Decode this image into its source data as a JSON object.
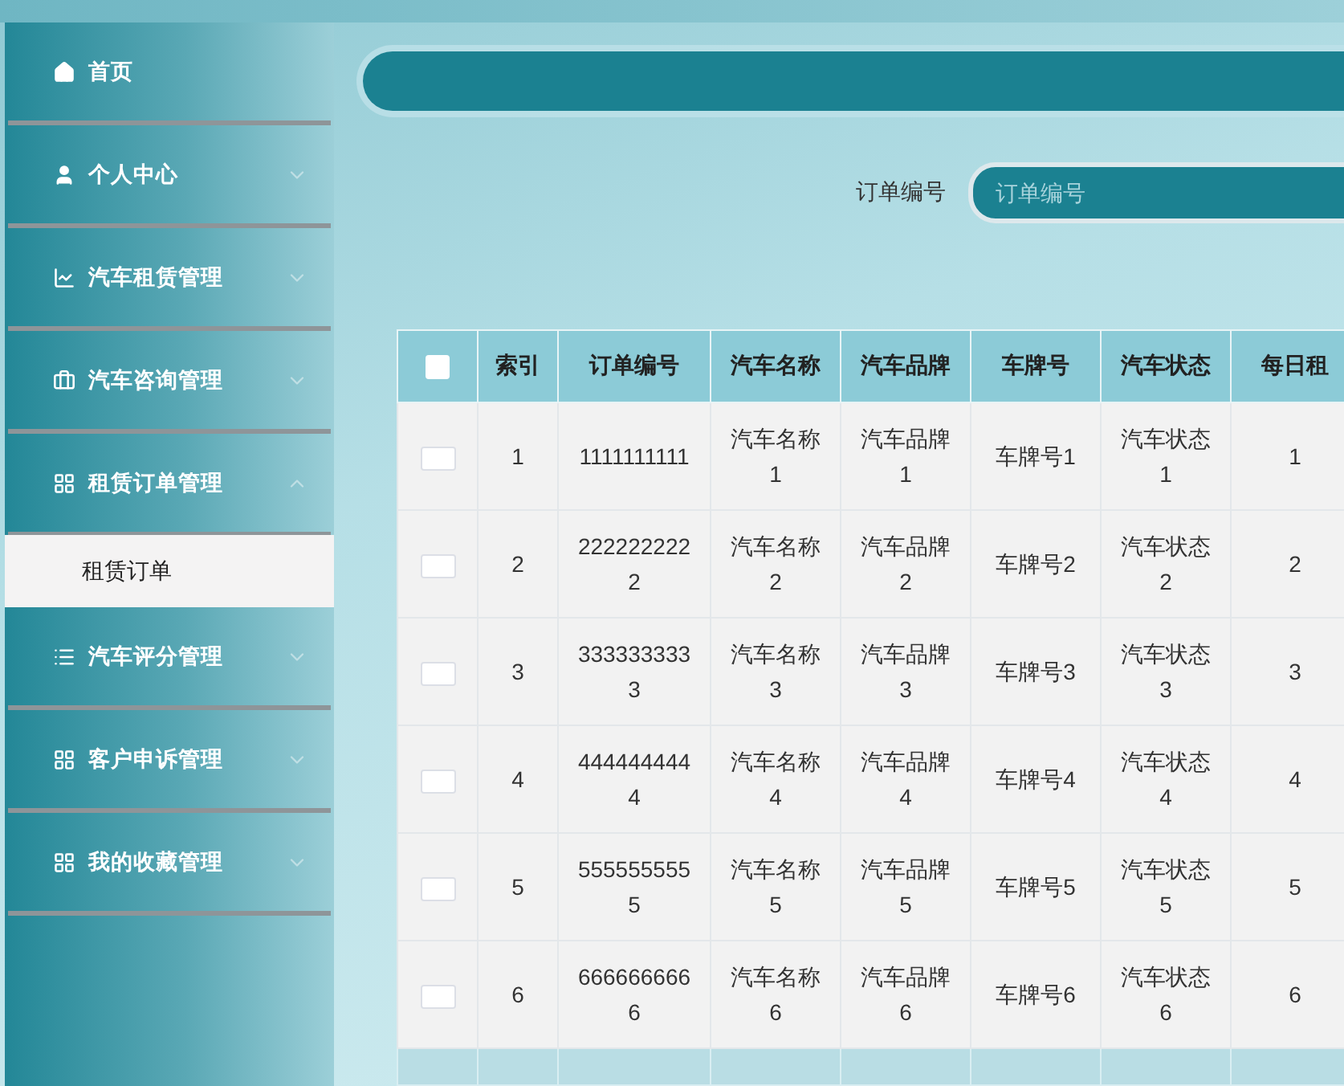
{
  "sidebar": {
    "items": [
      {
        "label": "首页"
      },
      {
        "label": "个人中心",
        "expanded": false
      },
      {
        "label": "汽车租赁管理",
        "expanded": false
      },
      {
        "label": "汽车咨询管理",
        "expanded": false
      },
      {
        "label": "租赁订单管理",
        "expanded": true,
        "children": [
          {
            "label": "租赁订单",
            "selected": true
          }
        ]
      },
      {
        "label": "汽车评分管理",
        "expanded": false
      },
      {
        "label": "客户申诉管理",
        "expanded": false
      },
      {
        "label": "我的收藏管理",
        "expanded": false
      }
    ]
  },
  "search": {
    "label": "订单编号",
    "placeholder": "订单编号"
  },
  "table": {
    "header_checked": false,
    "columns": [
      "索引",
      "订单编号",
      "汽车名称",
      "汽车品牌",
      "车牌号",
      "汽车状态",
      "每日租"
    ],
    "rows": [
      {
        "checked": false,
        "cells": [
          "1",
          "1111111111",
          "汽车名称1",
          "汽车品牌1",
          "车牌号1",
          "汽车状态1",
          "1"
        ]
      },
      {
        "checked": false,
        "cells": [
          "2",
          "2222222222",
          "汽车名称2",
          "汽车品牌2",
          "车牌号2",
          "汽车状态2",
          "2"
        ]
      },
      {
        "checked": false,
        "cells": [
          "3",
          "3333333333",
          "汽车名称3",
          "汽车品牌3",
          "车牌号3",
          "汽车状态3",
          "3"
        ]
      },
      {
        "checked": false,
        "cells": [
          "4",
          "4444444444",
          "汽车名称4",
          "汽车品牌4",
          "车牌号4",
          "汽车状态4",
          "4"
        ]
      },
      {
        "checked": false,
        "cells": [
          "5",
          "5555555555",
          "汽车名称5",
          "汽车品牌5",
          "车牌号5",
          "汽车状态5",
          "5"
        ]
      },
      {
        "checked": false,
        "cells": [
          "6",
          "6666666666",
          "汽车名称6",
          "汽车品牌6",
          "车牌号6",
          "汽车状态6",
          "6"
        ]
      }
    ]
  }
}
